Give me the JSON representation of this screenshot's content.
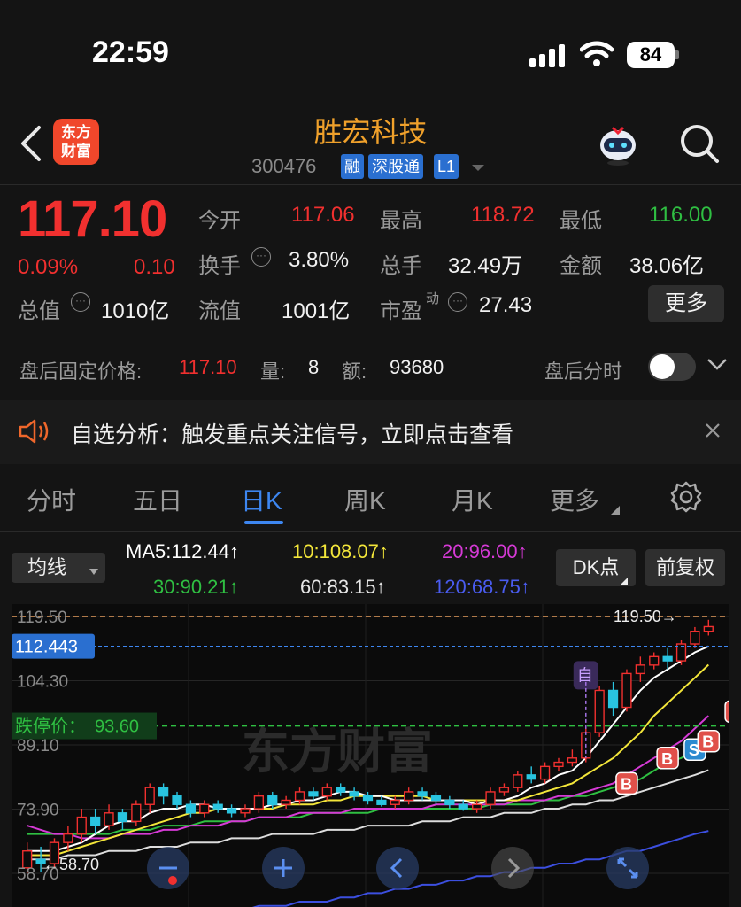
{
  "status_bar": {
    "time": "22:59",
    "battery": "84"
  },
  "header": {
    "logo_text": "东方财富",
    "name": "胜宏科技",
    "code": "300476",
    "tags": [
      "融",
      "深股通",
      "L1"
    ]
  },
  "quote": {
    "price": "117.10",
    "change_pct": "0.09%",
    "change": "0.10",
    "fields": {
      "open_label": "今开",
      "open": "117.06",
      "high_label": "最高",
      "high": "118.72",
      "low_label": "最低",
      "low": "116.00",
      "turnover_label": "换手",
      "turnover": "3.80%",
      "volume_label": "总手",
      "volume": "32.49万",
      "amount_label": "金额",
      "amount": "38.06亿",
      "mktcap_label": "总值",
      "mktcap": "1010亿",
      "float_label": "流值",
      "float": "1001亿",
      "pe_label": "市盈",
      "pe_sup": "动",
      "pe": "27.43"
    },
    "more_label": "更多"
  },
  "after_hours": {
    "price_label": "盘后固定价格:",
    "price": "117.10",
    "qty_label": "量:",
    "qty": "8",
    "amount_label": "额:",
    "amount": "93680",
    "toggle_label": "盘后分时"
  },
  "notice": {
    "text": "自选分析：触发重点关注信号，立即点击查看"
  },
  "tabs": [
    "分时",
    "五日",
    "日K",
    "周K",
    "月K",
    "更多"
  ],
  "active_tab": "日K",
  "indicators": {
    "select_label": "均线",
    "ma5": "MA5:112.44↑",
    "ma10": "10:108.07↑",
    "ma20": "20:96.00↑",
    "ma30": "30:90.21↑",
    "ma60": "60:83.15↑",
    "ma120": "120:68.75↑",
    "dk_label": "DK点",
    "adjust_label": "前复权"
  },
  "colors": {
    "up": "#f1302f",
    "down": "#2fbf42",
    "ma5": "#ffffff",
    "ma10": "#f3e63a",
    "ma20": "#d63ad6",
    "ma30": "#2fbf42",
    "ma60": "#dddddd",
    "ma120": "#3c4fe0",
    "accent": "#3d86f0"
  },
  "chart_data": {
    "type": "candlestick",
    "price_labels": [
      "119.50",
      "104.30",
      "89.10",
      "73.90",
      "58.70"
    ],
    "ylim": [
      58.7,
      119.5
    ],
    "current_price_tag": "112.443",
    "high_marker": "119.50→",
    "low_marker": "←58.70",
    "limit_label": "跌停价：",
    "limit_value": "93.60",
    "marker_labels": {
      "self": "自",
      "buy": "B",
      "sell": "S"
    },
    "watermark": "东方财富",
    "candles": [
      [
        60,
        64,
        58.7,
        66
      ],
      [
        62,
        61,
        59,
        65
      ],
      [
        61,
        66,
        60,
        67
      ],
      [
        66,
        68,
        64,
        70
      ],
      [
        68,
        72,
        66,
        74
      ],
      [
        72,
        70,
        68,
        74
      ],
      [
        70,
        73,
        69,
        75
      ],
      [
        73,
        71,
        69,
        74
      ],
      [
        71,
        75,
        70,
        76
      ],
      [
        75,
        79,
        73,
        80
      ],
      [
        79,
        77,
        75,
        80
      ],
      [
        77,
        75,
        74,
        78
      ],
      [
        75,
        73,
        72,
        76
      ],
      [
        73,
        75,
        72,
        76
      ],
      [
        75,
        74,
        73,
        76
      ],
      [
        74,
        73,
        72,
        75
      ],
      [
        73,
        74,
        72,
        75
      ],
      [
        74,
        77,
        73,
        78
      ],
      [
        77,
        75,
        74,
        78
      ],
      [
        75,
        76,
        74,
        77
      ],
      [
        76,
        78,
        75,
        79
      ],
      [
        78,
        77,
        76,
        79
      ],
      [
        77,
        79,
        76,
        80
      ],
      [
        79,
        78,
        77,
        80
      ],
      [
        78,
        77,
        76,
        79
      ],
      [
        77,
        76,
        75,
        78
      ],
      [
        76,
        75,
        74.5,
        77
      ],
      [
        75,
        76,
        74,
        77
      ],
      [
        76,
        78,
        75,
        79
      ],
      [
        78,
        77,
        76,
        79
      ],
      [
        77,
        76,
        75,
        78
      ],
      [
        76,
        75,
        74,
        77
      ],
      [
        75,
        74,
        73.5,
        76
      ],
      [
        74,
        75,
        73,
        76
      ],
      [
        75,
        78,
        74,
        79
      ],
      [
        78,
        79,
        77,
        80
      ],
      [
        79,
        82,
        78,
        83
      ],
      [
        82,
        81,
        80,
        84
      ],
      [
        81,
        84,
        80,
        85
      ],
      [
        84,
        85,
        83,
        86
      ],
      [
        85,
        86,
        84,
        88
      ],
      [
        86,
        92,
        85,
        93
      ],
      [
        92,
        102,
        91,
        103
      ],
      [
        102,
        98,
        96,
        104
      ],
      [
        98,
        106,
        97,
        107
      ],
      [
        106,
        108,
        104,
        110
      ],
      [
        108,
        110,
        107,
        111
      ],
      [
        110,
        109,
        107,
        112
      ],
      [
        109,
        113,
        108,
        114
      ],
      [
        113,
        116,
        112,
        117
      ],
      [
        116,
        117.1,
        115,
        118.7
      ]
    ],
    "ma5": [
      64,
      64,
      64,
      65,
      66,
      68,
      70,
      71,
      71,
      73,
      74,
      74,
      75,
      75,
      74,
      74,
      74,
      74,
      75,
      75,
      76,
      76,
      77,
      78,
      78,
      77,
      77,
      76,
      76,
      76,
      76,
      76,
      76,
      75,
      76,
      76,
      77,
      79,
      80,
      82,
      83,
      86,
      90,
      94,
      98,
      102,
      105,
      107,
      109,
      111,
      112.44
    ],
    "ma10": [
      63,
      63,
      63,
      64,
      65,
      66,
      67,
      68,
      69,
      70,
      71,
      72,
      73,
      73,
      74,
      74,
      74,
      74,
      74,
      75,
      75,
      75,
      76,
      76,
      77,
      77,
      77,
      77,
      77,
      77,
      76,
      76,
      76,
      76,
      76,
      76,
      76,
      77,
      78,
      79,
      80,
      82,
      84,
      86,
      89,
      92,
      96,
      99,
      102,
      105,
      108.07
    ],
    "ma20": [
      70,
      69,
      68,
      68,
      67,
      67,
      67,
      68,
      68,
      68,
      69,
      69,
      70,
      70,
      70,
      71,
      71,
      72,
      72,
      72,
      73,
      73,
      73,
      73,
      74,
      74,
      74,
      74,
      74,
      74,
      75,
      75,
      75,
      75,
      75,
      75,
      76,
      76,
      76,
      77,
      77,
      78,
      79,
      80,
      82,
      84,
      86,
      88,
      90,
      93,
      96.0
    ],
    "ma30": [
      68,
      68,
      68,
      68,
      68,
      68,
      68,
      69,
      69,
      69,
      70,
      70,
      70,
      71,
      71,
      71,
      71,
      72,
      72,
      72,
      72,
      73,
      73,
      73,
      73,
      73,
      74,
      74,
      74,
      74,
      74,
      74,
      74,
      74,
      75,
      75,
      75,
      75,
      76,
      76,
      77,
      77,
      78,
      79,
      80,
      81,
      83,
      85,
      86,
      88,
      90.21
    ],
    "ma60": [
      62,
      62,
      62,
      63,
      63,
      63,
      64,
      64,
      64,
      65,
      65,
      65,
      66,
      66,
      66,
      67,
      67,
      67,
      68,
      68,
      68,
      68,
      69,
      69,
      69,
      70,
      70,
      70,
      70,
      71,
      71,
      71,
      72,
      72,
      72,
      73,
      73,
      73,
      74,
      74,
      75,
      75,
      76,
      76,
      77,
      78,
      79,
      80,
      81,
      82,
      83.15
    ],
    "ma120": [
      45,
      45,
      46,
      46,
      46,
      47,
      47,
      47,
      48,
      48,
      48,
      49,
      49,
      49,
      50,
      50,
      50,
      51,
      51,
      51,
      52,
      52,
      52,
      53,
      53,
      54,
      54,
      55,
      55,
      56,
      56,
      57,
      57,
      58,
      58,
      59,
      59,
      60,
      60,
      61,
      61,
      62,
      62,
      63,
      64,
      64,
      65,
      66,
      67,
      68,
      68.75
    ]
  }
}
